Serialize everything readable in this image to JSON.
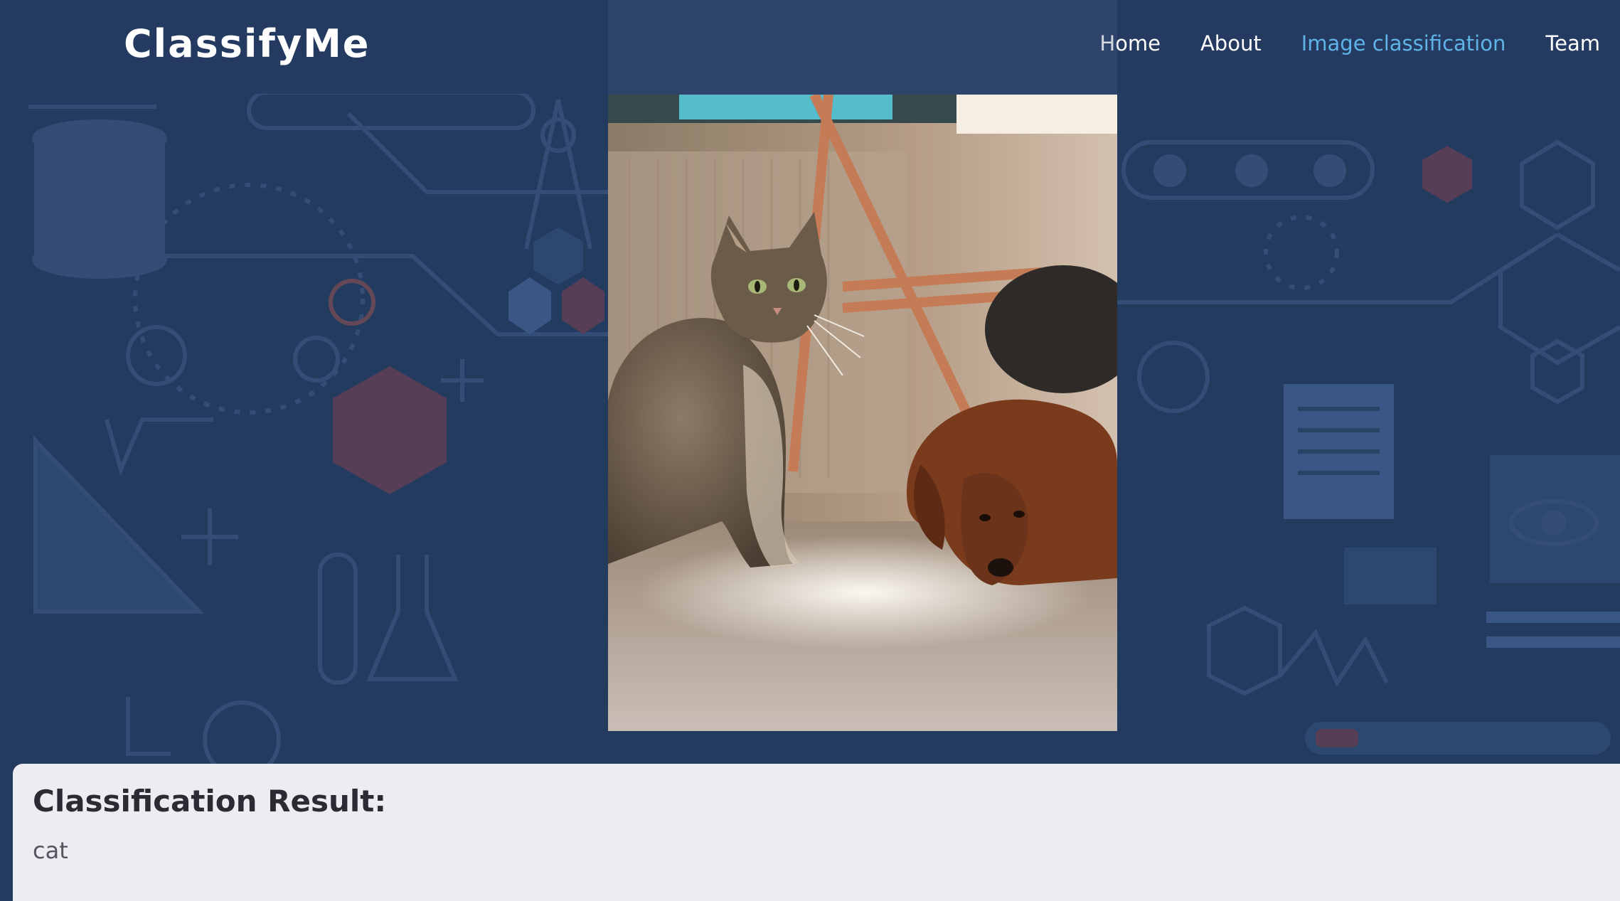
{
  "brand": {
    "name": "ClassifyMe"
  },
  "nav": {
    "items": [
      {
        "label": "Home",
        "active": false
      },
      {
        "label": "About",
        "active": false
      },
      {
        "label": "Image classification",
        "active": true
      },
      {
        "label": "Team",
        "active": false
      }
    ]
  },
  "result": {
    "title": "Classification Result:",
    "value": "cat"
  },
  "colors": {
    "background": "#243b60",
    "active_link": "#5fb3e6",
    "card": "#ecedf2"
  }
}
